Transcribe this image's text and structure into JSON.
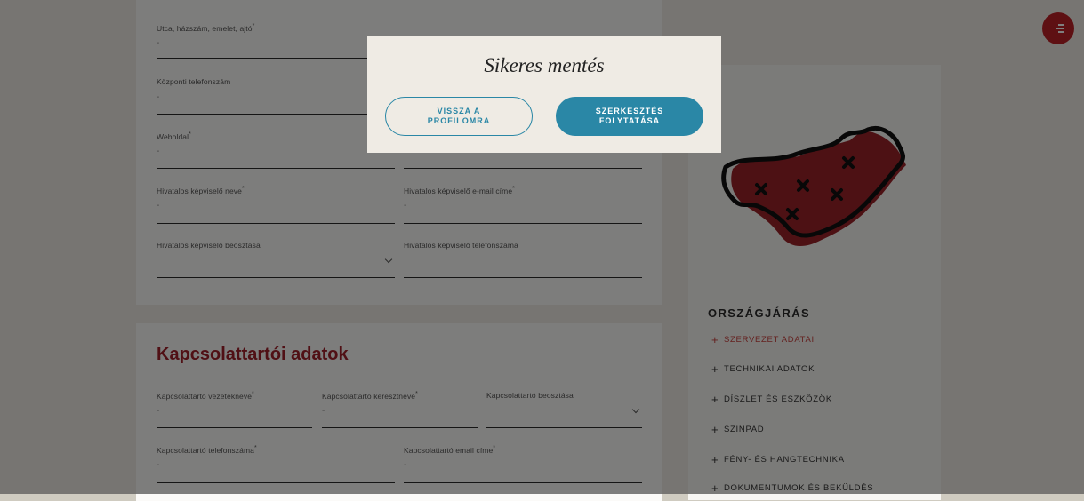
{
  "form_fields": {
    "street": {
      "label": "Utca, házszám, emelet, ajtó",
      "required": "*",
      "value": "-"
    },
    "phone": {
      "label": "Központi telefonszám",
      "value": "-"
    },
    "website": {
      "label": "Weboldal",
      "required": "*",
      "value": "-"
    },
    "email_right": {
      "value": "-"
    },
    "rep_name": {
      "label": "Hivatalos képviselő neve",
      "required": "*",
      "value": "-"
    },
    "rep_email": {
      "label": "Hivatalos képviselő e-mail címe",
      "required": "*",
      "value": "-"
    },
    "rep_position": {
      "label": "Hivatalos képviselő beosztása",
      "value": ""
    },
    "rep_phone": {
      "label": "Hivatalos képviselő telefonszáma",
      "value": ""
    }
  },
  "contact_section": {
    "title": "Kapcsolattartói adatok",
    "last_name": {
      "label": "Kapcsolattartó vezetékneve",
      "required": "*",
      "value": "-"
    },
    "first_name": {
      "label": "Kapcsolattartó keresztneve",
      "required": "*",
      "value": "-"
    },
    "position": {
      "label": "Kapcsolattartó beosztása",
      "value": ""
    },
    "phone": {
      "label": "Kapcsolattartó telefonszáma",
      "required": "*",
      "value": "-"
    },
    "email": {
      "label": "Kapcsolattartó email címe",
      "required": "*",
      "value": "-"
    }
  },
  "sidebar": {
    "title": "ORSZÁGJÁRÁS",
    "items": [
      {
        "label": "SZERVEZET ADATAI",
        "active": true
      },
      {
        "label": "TECHNIKAI ADATOK"
      },
      {
        "label": "DÍSZLET ÉS ESZKÖZÖK"
      },
      {
        "label": "SZÍNPAD"
      },
      {
        "label": "FÉNY- ÉS HANGTECHNIKA"
      },
      {
        "label": "DOKUMENTUMOK ÉS BEKÜLDÉS"
      }
    ],
    "plus_icon": "+"
  },
  "map_icon": "hungary-map-illustration",
  "colors": {
    "accent_red": "#bd2026",
    "teal": "#2a87a6",
    "map_fill": "#9a2328"
  },
  "modal": {
    "title": "Sikeres mentés",
    "back_button": "VISSZA A PROFILOMRA",
    "continue_button": "SZERKESZTÉS FOLYTATÁSA"
  }
}
